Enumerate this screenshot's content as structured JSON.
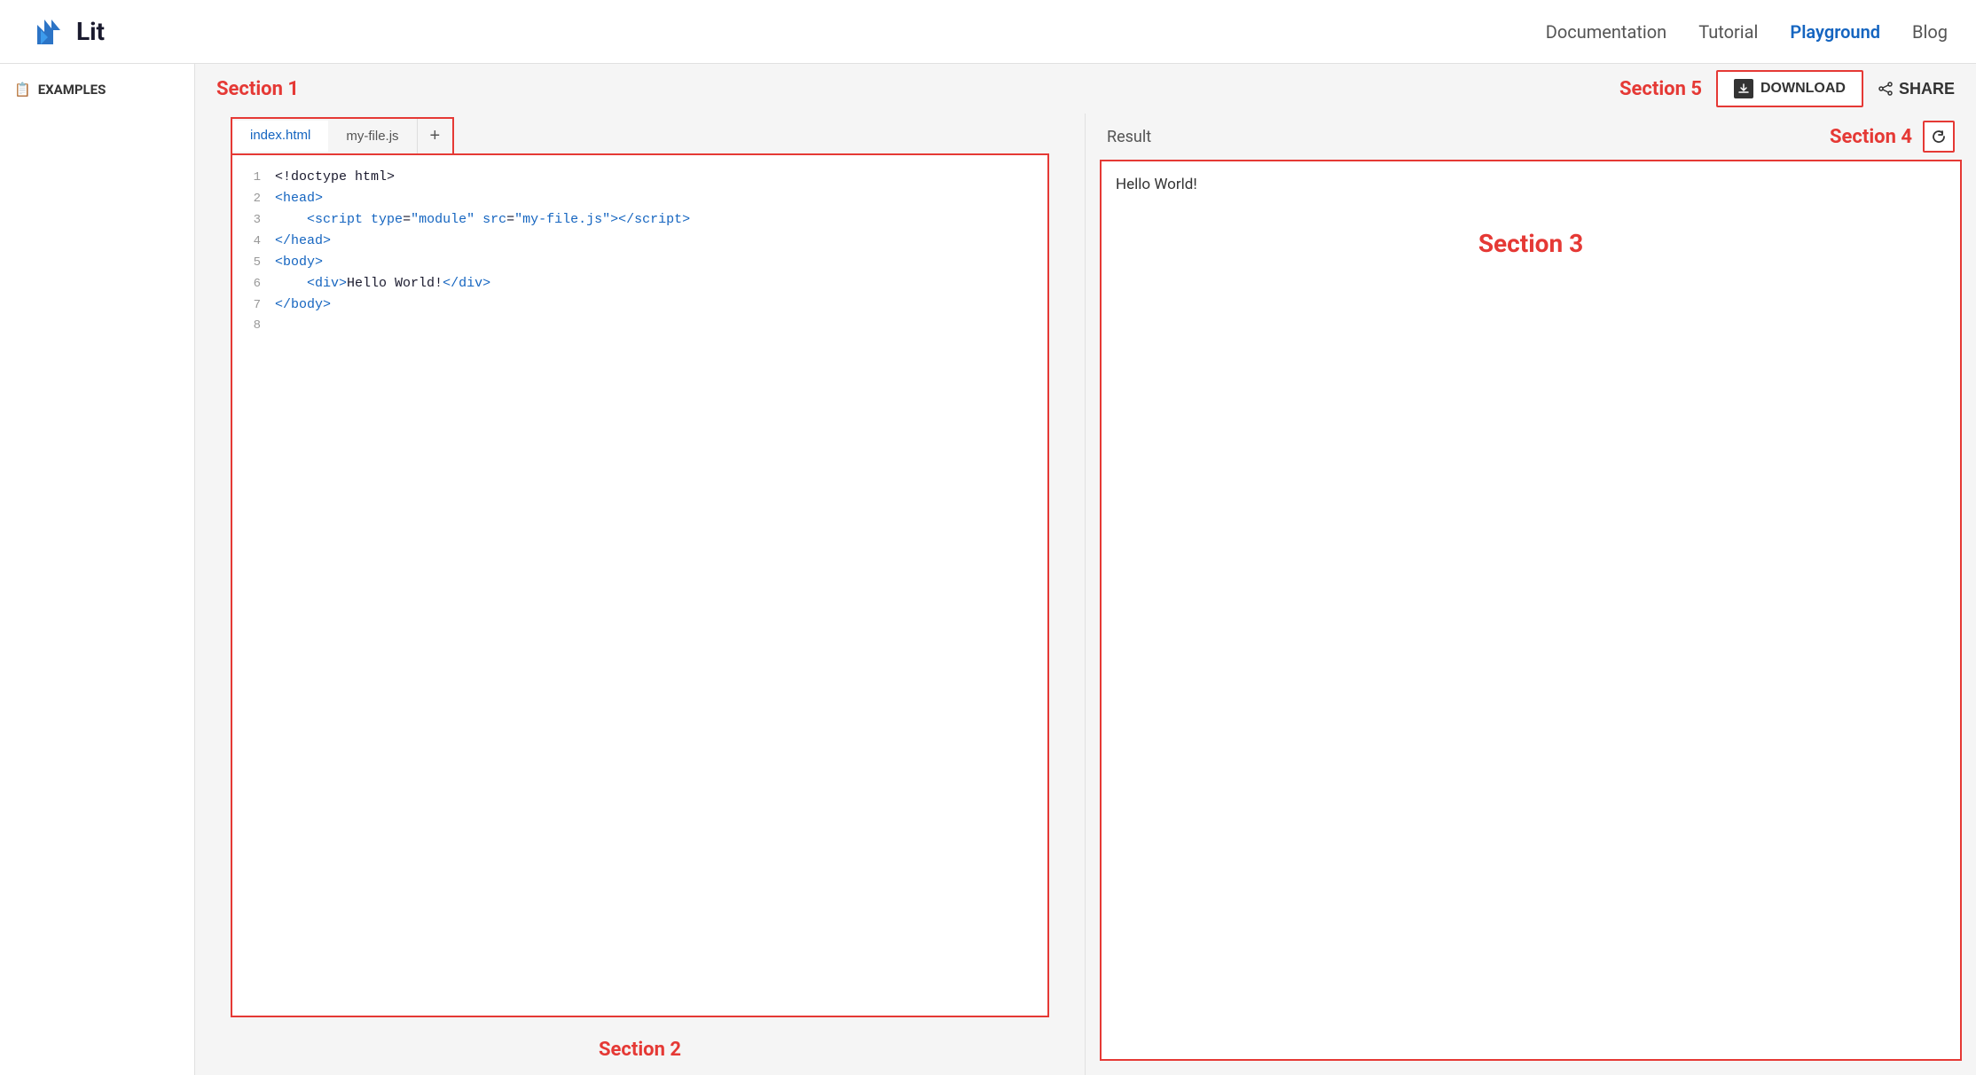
{
  "nav": {
    "logo_text": "Lit",
    "links": [
      {
        "label": "Documentation",
        "active": false
      },
      {
        "label": "Tutorial",
        "active": false
      },
      {
        "label": "Playground",
        "active": true
      },
      {
        "label": "Blog",
        "active": false
      }
    ]
  },
  "sidebar": {
    "title": "EXAMPLES"
  },
  "toolbar": {
    "section1_label": "Section 1",
    "section5_label": "Section 5",
    "download_label": "DOWNLOAD",
    "share_label": "SHARE"
  },
  "tabs": [
    {
      "label": "index.html",
      "active": true
    },
    {
      "label": "my-file.js",
      "active": false
    }
  ],
  "code": {
    "lines": [
      {
        "num": "1",
        "content": "<!doctype html>"
      },
      {
        "num": "2",
        "content": "<head>"
      },
      {
        "num": "3",
        "content": "    <script type=\"module\" src=\"my-file.js\"></script>"
      },
      {
        "num": "4",
        "content": "</head>"
      },
      {
        "num": "5",
        "content": "<body>"
      },
      {
        "num": "6",
        "content": "    <div>Hello World!</div>"
      },
      {
        "num": "7",
        "content": "</body>"
      },
      {
        "num": "8",
        "content": ""
      }
    ]
  },
  "section2_label": "Section 2",
  "preview": {
    "result_label": "Result",
    "section4_label": "Section 4",
    "section3_label": "Section 3",
    "hello_world": "Hello World!"
  }
}
